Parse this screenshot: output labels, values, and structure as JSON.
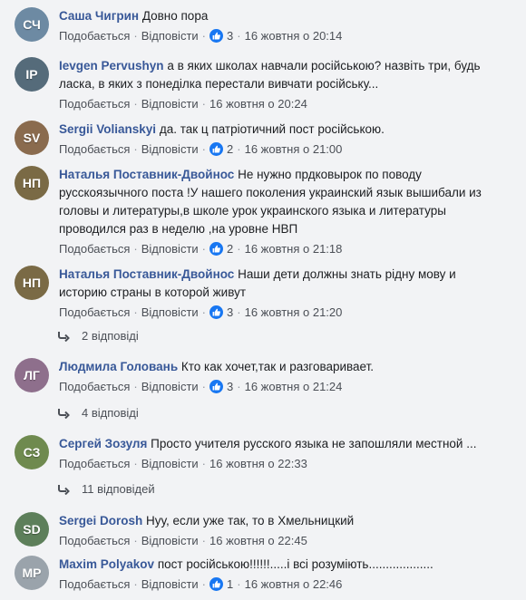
{
  "labels": {
    "like": "Подобається",
    "reply": "Відповісти"
  },
  "colors": {
    "author": "#385898",
    "like_badge": "#1877f2",
    "meta": "#90949c"
  },
  "comments": [
    {
      "author": "Саша Чигрин",
      "lines": [
        "Довно пора"
      ],
      "likes": "3",
      "time": "16 жовтня о 20:14",
      "avatar": {
        "initials": "СЧ",
        "color": "#6d8aa3"
      }
    },
    {
      "author": "Ievgen Pervushyn",
      "lines": [
        "а в яких школах навчали російською? назвіть три, будь",
        "ласка, в яких з понеділка перестали вивчати російську..."
      ],
      "likes": "",
      "time": "16 жовтня о 20:24",
      "avatar": {
        "initials": "IP",
        "color": "#556b7a"
      }
    },
    {
      "author": "Sergii Volianskyi",
      "lines": [
        "да. так ц патріотичний пост російською."
      ],
      "likes": "2",
      "time": "16 жовтня о 21:00",
      "avatar": {
        "initials": "SV",
        "color": "#8a6b4e"
      }
    },
    {
      "author": "Наталья Поставник-Двойнос",
      "lines": [
        "Не нужно прдковырок по поводу",
        "русскоязычного поста !У нашего поколения украинский язык вышибали из",
        "головы и литературы,в школе урок украинского языка и литературы",
        "проводился раз в неделю ,на уровне НВП"
      ],
      "likes": "2",
      "time": "16 жовтня о 21:18",
      "avatar": {
        "initials": "НП",
        "color": "#7a6a45"
      }
    },
    {
      "author": "Наталья Поставник-Двойнос",
      "lines": [
        "Наши дети должны знать рідну мову и",
        "историю страны в которой живут"
      ],
      "likes": "3",
      "time": "16 жовтня о 21:20",
      "replies": "2 відповіді",
      "avatar": {
        "initials": "НП",
        "color": "#7a6a45"
      }
    },
    {
      "author": "Людмила Головань",
      "lines": [
        "Кто как хочет,так и разговаривает."
      ],
      "likes": "3",
      "time": "16 жовтня о 21:24",
      "replies": "4 відповіді",
      "avatar": {
        "initials": "ЛГ",
        "color": "#8e6f8c"
      }
    },
    {
      "author": "Сергей Зозуля",
      "lines": [
        "Просто учителя русского языка не запошляли местной ..."
      ],
      "likes": "",
      "time": "16 жовтня о 22:33",
      "replies": "11 відповідей",
      "avatar": {
        "initials": "СЗ",
        "color": "#6f8a4f"
      }
    },
    {
      "author": "Sergei Dorosh",
      "lines": [
        "Нуу, если уже так, то в Хмельницкий"
      ],
      "likes": "",
      "time": "16 жовтня о 22:45",
      "avatar": {
        "initials": "SD",
        "color": "#5d7f5a"
      }
    },
    {
      "author": "Maxim Polyakov",
      "lines": [
        "пост російською!!!!!!.....і всі розуміють..................."
      ],
      "likes": "1",
      "time": "16 жовтня о 22:46",
      "avatar": {
        "initials": "MP",
        "color": "#9aa3ab"
      }
    }
  ]
}
